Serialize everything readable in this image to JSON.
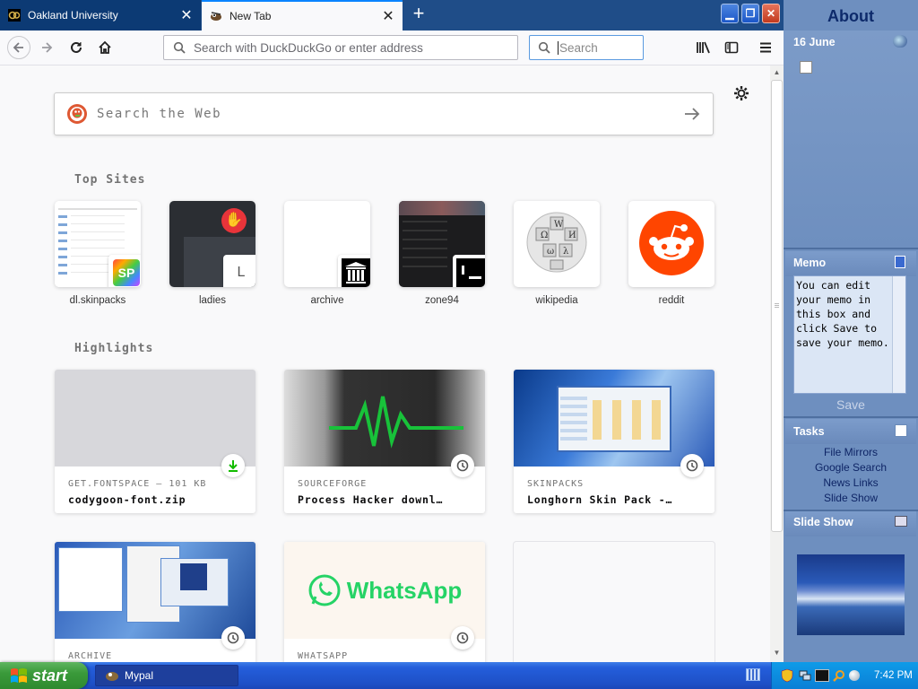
{
  "browser": {
    "tabs": [
      {
        "title": "Oakland University",
        "active": false
      },
      {
        "title": "New Tab",
        "active": true
      }
    ],
    "url_placeholder": "Search with DuckDuckGo or enter address",
    "search_placeholder": "Search"
  },
  "newtab": {
    "web_search_placeholder": "Search the Web",
    "top_sites_heading": "Top Sites",
    "top_sites": [
      {
        "label": "dl.skinpacks",
        "badge": "SP"
      },
      {
        "label": "ladies",
        "badge": "L"
      },
      {
        "label": "archive",
        "badge": "archive-icon"
      },
      {
        "label": "zone94",
        "badge": "zone94-icon"
      },
      {
        "label": "wikipedia",
        "badge": "wikipedia-icon"
      },
      {
        "label": "reddit",
        "badge": "reddit-icon"
      }
    ],
    "highlights_heading": "Highlights",
    "highlights": [
      {
        "meta": "GET.FONTSPACE — 101 KB",
        "title": "codygoon-font.zip",
        "badge": "download-icon"
      },
      {
        "meta": "SOURCEFORGE",
        "title": "Process Hacker downl…",
        "badge": "clock-icon"
      },
      {
        "meta": "SKINPACKS",
        "title": "Longhorn Skin Pack -…",
        "badge": "clock-icon"
      },
      {
        "meta": "ARCHIVE",
        "title": "",
        "badge": "clock-icon"
      },
      {
        "meta": "WHATSAPP",
        "title": "",
        "badge": "clock-icon",
        "image_text": "WhatsApp"
      },
      {
        "meta": "",
        "title": "",
        "badge": ""
      }
    ]
  },
  "sidebar": {
    "title": "About",
    "date": "16 June",
    "memo_heading": "Memo",
    "memo_text": "You can edit your memo in this box and click Save to save your memo.",
    "save_label": "Save",
    "tasks_heading": "Tasks",
    "tasks": [
      "File Mirrors",
      "Google Search",
      "News Links",
      "Slide Show"
    ],
    "slideshow_heading": "Slide Show"
  },
  "taskbar": {
    "start_label": "start",
    "task_item": "Mypal",
    "clock": "7:42 PM"
  },
  "colors": {
    "accent": "#0a84ff",
    "sidebar_bg": "#6e8fbf",
    "taskbar_blue": "#245edb",
    "start_green": "#3a9a3a",
    "whatsapp_green": "#25d366",
    "reddit_orange": "#ff4500"
  }
}
